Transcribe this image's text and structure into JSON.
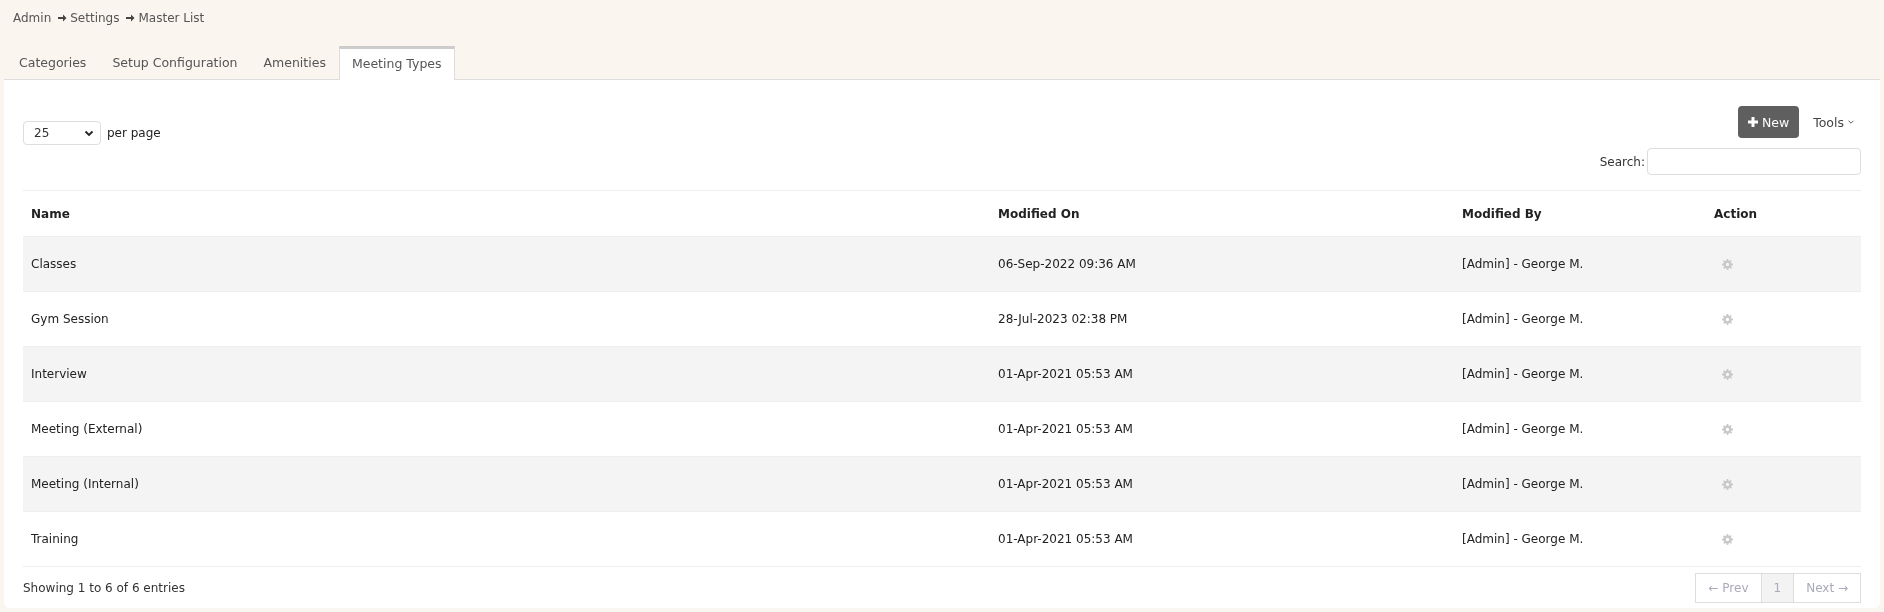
{
  "breadcrumb": [
    {
      "label": "Admin",
      "arrow": false
    },
    {
      "label": "Settings",
      "arrow": true
    },
    {
      "label": "Master List",
      "arrow": true
    }
  ],
  "tabs": [
    {
      "label": "Categories",
      "selected": false
    },
    {
      "label": "Setup Configuration",
      "selected": false
    },
    {
      "label": "Amenities",
      "selected": false
    },
    {
      "label": "Meeting Types",
      "selected": true
    }
  ],
  "page_size": {
    "value": "25",
    "label": "per page"
  },
  "new_button": "New",
  "tools_button": "Tools",
  "search": {
    "label": "Search:"
  },
  "table": {
    "columns": [
      "Name",
      "Modified On",
      "Modified By",
      "Action"
    ],
    "rows": [
      {
        "name": "Classes",
        "modified_on": "06-Sep-2022 09:36 AM",
        "modified_by": "[Admin] - George M."
      },
      {
        "name": "Gym Session",
        "modified_on": "28-Jul-2023 02:38 PM",
        "modified_by": "[Admin] - George M."
      },
      {
        "name": "Interview",
        "modified_on": "01-Apr-2021 05:53 AM",
        "modified_by": "[Admin] - George M."
      },
      {
        "name": "Meeting (External)",
        "modified_on": "01-Apr-2021 05:53 AM",
        "modified_by": "[Admin] - George M."
      },
      {
        "name": "Meeting (Internal)",
        "modified_on": "01-Apr-2021 05:53 AM",
        "modified_by": "[Admin] - George M."
      },
      {
        "name": "Training",
        "modified_on": "01-Apr-2021 05:53 AM",
        "modified_by": "[Admin] - George M."
      }
    ]
  },
  "footer": {
    "info": "Showing 1 to 6 of 6 entries",
    "pagination": [
      {
        "label": "← Prev",
        "selected": false
      },
      {
        "label": "1",
        "selected": true
      },
      {
        "label": "Next →",
        "selected": false
      }
    ]
  }
}
